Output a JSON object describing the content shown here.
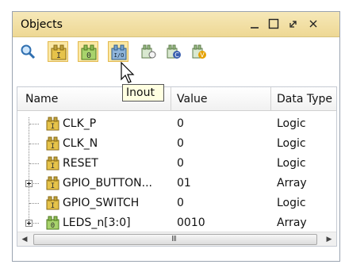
{
  "panel": {
    "title": "Objects",
    "window_buttons": [
      "minimize-icon",
      "maximize-icon",
      "restore-icon",
      "close-icon"
    ]
  },
  "toolbar": {
    "icons": [
      "search-icon",
      "input-filter-icon",
      "output-filter-icon",
      "inout-filter-icon",
      "internal-signal-icon",
      "constant-icon",
      "variable-icon"
    ]
  },
  "tooltip": {
    "text": "Inout"
  },
  "table": {
    "columns": [
      "Name",
      "Value",
      "Data Type"
    ],
    "rows": [
      {
        "name": "CLK_P",
        "value": "0",
        "type": "Logic",
        "expandable": false,
        "icon": "input-port-icon"
      },
      {
        "name": "CLK_N",
        "value": "0",
        "type": "Logic",
        "expandable": false,
        "icon": "input-port-icon"
      },
      {
        "name": "RESET",
        "value": "0",
        "type": "Logic",
        "expandable": false,
        "icon": "input-port-icon"
      },
      {
        "name": "GPIO_BUTTON...",
        "value": "01",
        "type": "Array",
        "expandable": true,
        "icon": "input-port-icon"
      },
      {
        "name": "GPIO_SWITCH",
        "value": "0",
        "type": "Logic",
        "expandable": false,
        "icon": "input-port-icon"
      },
      {
        "name": "LEDS_n[3:0]",
        "value": "0010",
        "type": "Array",
        "expandable": true,
        "icon": "output-port-icon"
      }
    ]
  },
  "scrollbar": {
    "grip": "III"
  },
  "colors": {
    "titlebar": "#f2dfa2",
    "active_toolbar": "#fbe8a5",
    "tooltip_bg": "#ffffe1"
  }
}
